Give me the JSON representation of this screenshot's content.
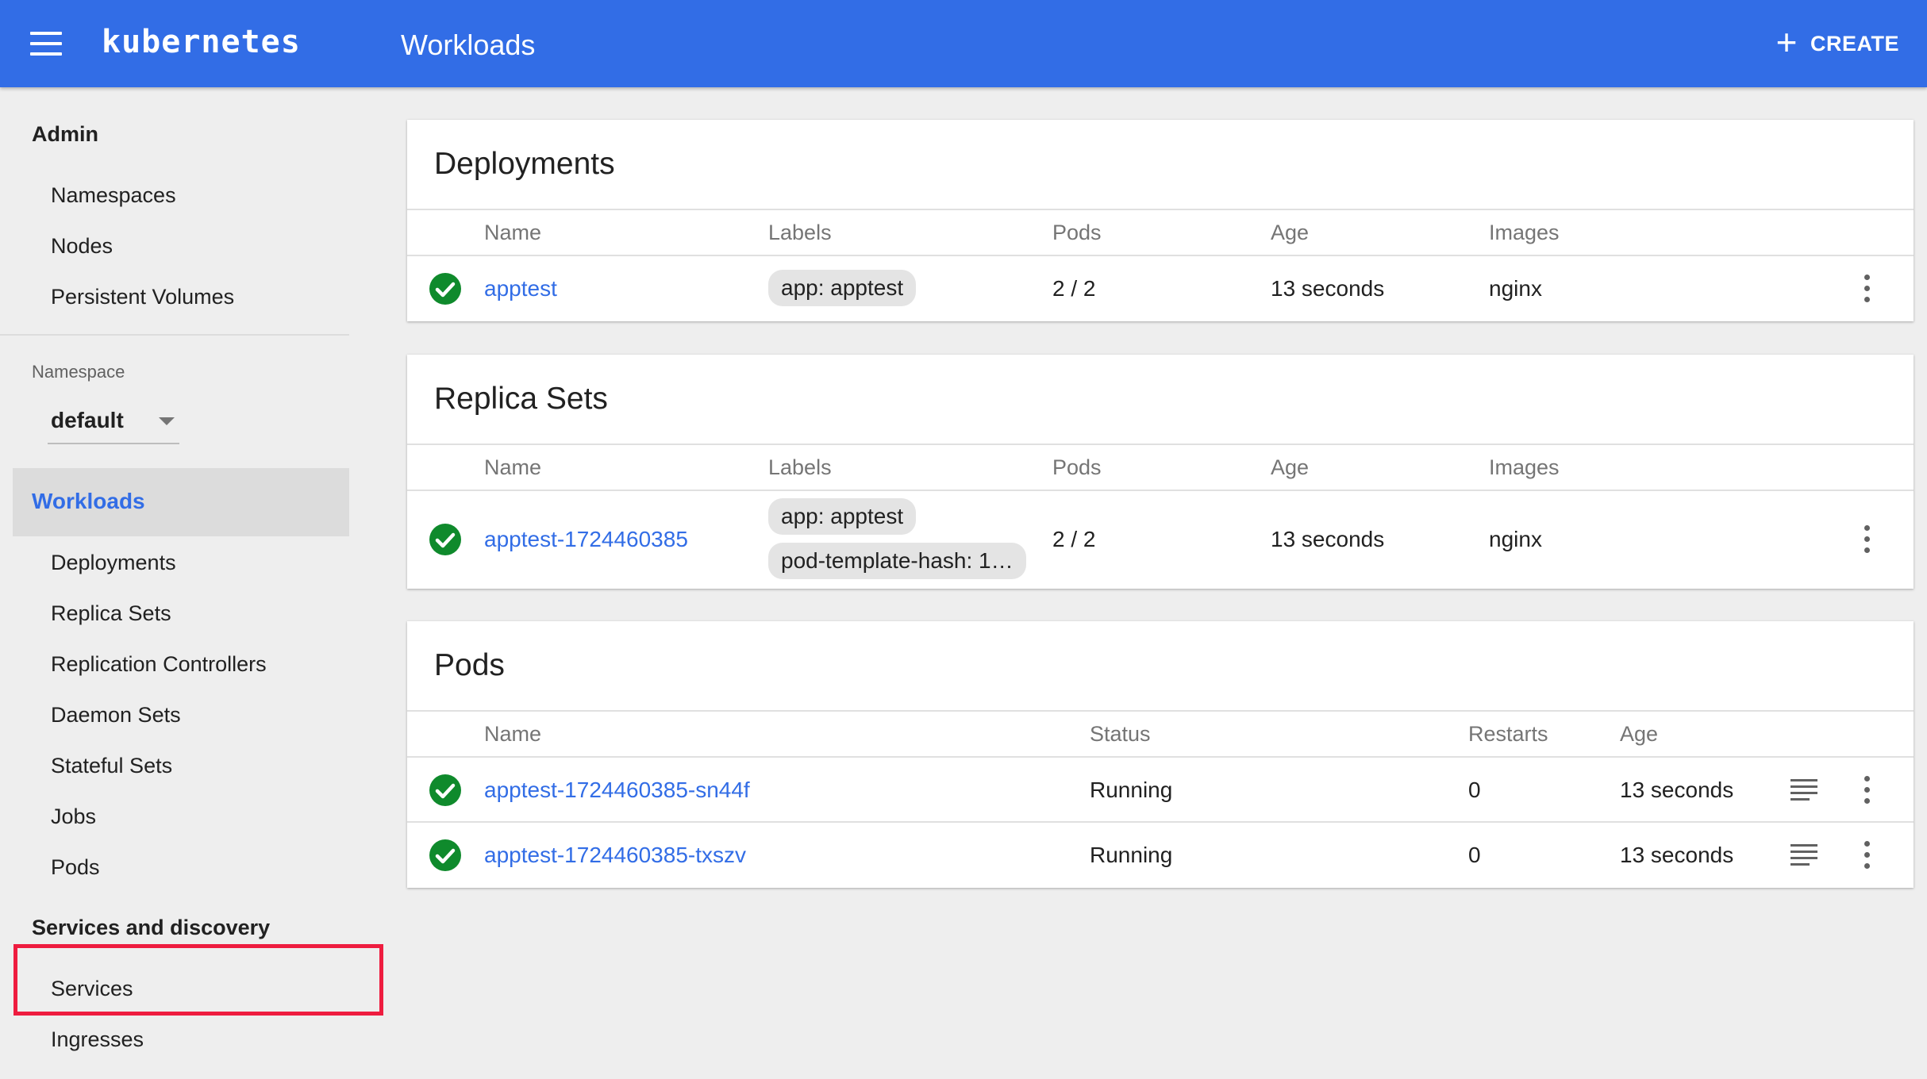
{
  "header": {
    "brand": "kubernetes",
    "title": "Workloads",
    "create_label": "CREATE"
  },
  "sidebar": {
    "admin_label": "Admin",
    "admin_items": [
      "Namespaces",
      "Nodes",
      "Persistent Volumes"
    ],
    "namespace_label": "Namespace",
    "namespace_value": "default",
    "workloads_label": "Workloads",
    "workload_items": [
      "Deployments",
      "Replica Sets",
      "Replication Controllers",
      "Daemon Sets",
      "Stateful Sets",
      "Jobs",
      "Pods"
    ],
    "discovery_label": "Services and discovery",
    "discovery_items": [
      "Services",
      "Ingresses"
    ]
  },
  "deployments": {
    "title": "Deployments",
    "headers": [
      "Name",
      "Labels",
      "Pods",
      "Age",
      "Images"
    ],
    "rows": [
      {
        "name": "apptest",
        "labels": [
          "app: apptest"
        ],
        "pods": "2 / 2",
        "age": "13 seconds",
        "images": "nginx"
      }
    ]
  },
  "replica_sets": {
    "title": "Replica Sets",
    "headers": [
      "Name",
      "Labels",
      "Pods",
      "Age",
      "Images"
    ],
    "rows": [
      {
        "name": "apptest-1724460385",
        "labels": [
          "app: apptest",
          "pod-template-hash: 1…"
        ],
        "pods": "2 / 2",
        "age": "13 seconds",
        "images": "nginx"
      }
    ]
  },
  "pods": {
    "title": "Pods",
    "headers": [
      "Name",
      "Status",
      "Restarts",
      "Age"
    ],
    "rows": [
      {
        "name": "apptest-1724460385-sn44f",
        "status": "Running",
        "restarts": "0",
        "age": "13 seconds"
      },
      {
        "name": "apptest-1724460385-txszv",
        "status": "Running",
        "restarts": "0",
        "age": "13 seconds"
      }
    ]
  },
  "colors": {
    "primary": "#326de6",
    "success": "#0f8a2c",
    "highlight": "#ee1c3f"
  }
}
